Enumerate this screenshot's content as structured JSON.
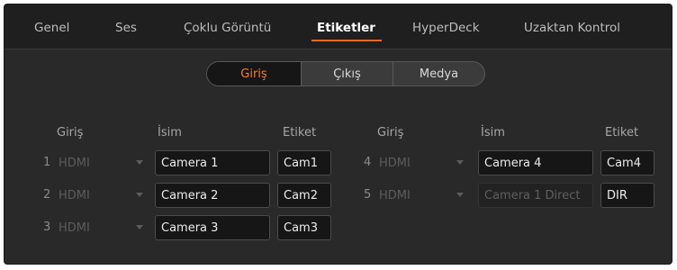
{
  "tabs": [
    {
      "label": "Genel",
      "active": false
    },
    {
      "label": "Ses",
      "active": false
    },
    {
      "label": "Çoklu Görüntü",
      "active": false
    },
    {
      "label": "Etiketler",
      "active": true
    },
    {
      "label": "HyperDeck",
      "active": false
    },
    {
      "label": "Uzaktan Kontrol",
      "active": false
    }
  ],
  "segments": [
    {
      "label": "Giriş",
      "active": true
    },
    {
      "label": "Çıkış",
      "active": false
    },
    {
      "label": "Medya",
      "active": false
    }
  ],
  "headers": {
    "input": "Giriş",
    "name": "İsim",
    "label": "Etiket"
  },
  "rows": [
    {
      "num": "1",
      "source": "HDMI",
      "name": "Camera 1",
      "label": "Cam1",
      "name_dimmed": false
    },
    {
      "num": "2",
      "source": "HDMI",
      "name": "Camera 2",
      "label": "Cam2",
      "name_dimmed": false
    },
    {
      "num": "3",
      "source": "HDMI",
      "name": "Camera 3",
      "label": "Cam3",
      "name_dimmed": false
    },
    {
      "num": "4",
      "source": "HDMI",
      "name": "Camera 4",
      "label": "Cam4",
      "name_dimmed": false
    },
    {
      "num": "5",
      "source": "HDMI",
      "name": "Camera 1 Direct",
      "label": "DIR",
      "name_dimmed": true
    }
  ],
  "colors": {
    "accent": "#e36a1f",
    "background": "#292929",
    "field_bg": "#161616"
  }
}
